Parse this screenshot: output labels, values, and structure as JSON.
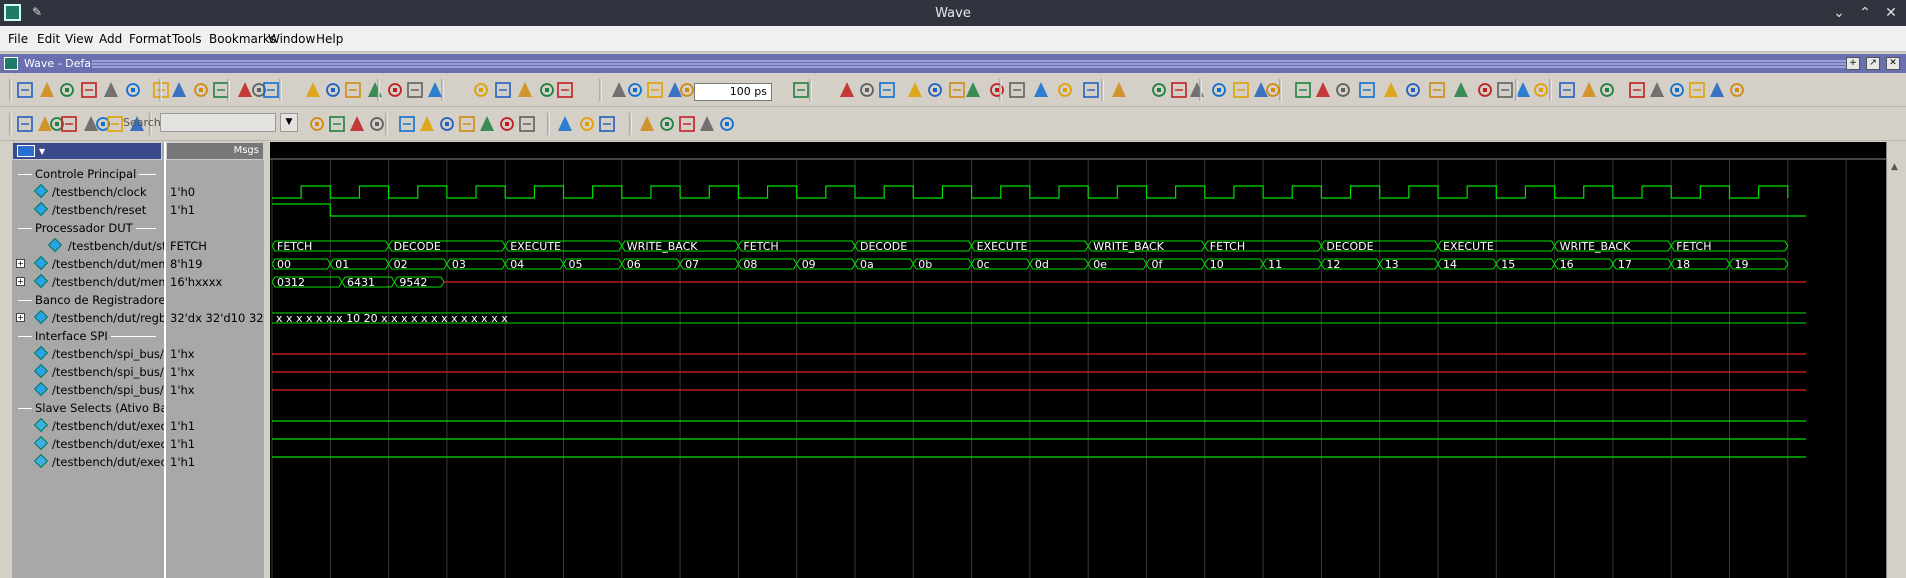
{
  "window": {
    "title": "Wave"
  },
  "menu": [
    "File",
    "Edit",
    "View",
    "Add",
    "Format",
    "Tools",
    "Bookmarks",
    "Window",
    "Help"
  ],
  "subwindow": {
    "title": "Wave - Default"
  },
  "toolbar": {
    "time_value": "100",
    "time_unit": "ps",
    "search_label": "Search:"
  },
  "columns": {
    "msgs": "Msgs"
  },
  "signals": [
    {
      "type": "group",
      "name": "Controle Principal"
    },
    {
      "type": "signal",
      "name": "/testbench/clock",
      "value": "1'h0",
      "icon": "wire-signal-icon"
    },
    {
      "type": "signal",
      "name": "/testbench/reset",
      "value": "1'h1",
      "icon": "wire-signal-icon"
    },
    {
      "type": "group",
      "name": "Processador DUT"
    },
    {
      "type": "signal",
      "name": "/testbench/dut/st...",
      "value": "FETCH",
      "icon": "state-machine-icon"
    },
    {
      "type": "signal",
      "name": "/testbench/dut/mem...",
      "value": "8'h19",
      "icon": "bus-signal-icon",
      "expandable": true
    },
    {
      "type": "signal",
      "name": "/testbench/dut/mem...",
      "value": "16'hxxxx",
      "icon": "bus-signal-icon",
      "expandable": true
    },
    {
      "type": "group",
      "name": "Banco de Registradores"
    },
    {
      "type": "signal",
      "name": "/testbench/dut/regb...",
      "value": "32'dx 32'd10 32'd...",
      "icon": "bus-signal-icon",
      "expandable": true
    },
    {
      "type": "group",
      "name": "Interface SPI"
    },
    {
      "type": "signal",
      "name": "/testbench/spi_bus/...",
      "value": "1'hx",
      "icon": "wire-signal-icon"
    },
    {
      "type": "signal",
      "name": "/testbench/spi_bus/...",
      "value": "1'hx",
      "icon": "wire-signal-icon"
    },
    {
      "type": "signal",
      "name": "/testbench/spi_bus/...",
      "value": "1'hx",
      "icon": "wire-signal-icon"
    },
    {
      "type": "group",
      "name": "Slave Selects (Ativo Bai"
    },
    {
      "type": "signal",
      "name": "/testbench/dut/exec...",
      "value": "1'h1",
      "icon": "output-signal-icon"
    },
    {
      "type": "signal",
      "name": "/testbench/dut/exec...",
      "value": "1'h1",
      "icon": "output-signal-icon"
    },
    {
      "type": "signal",
      "name": "/testbench/dut/exec...",
      "value": "1'h1",
      "icon": "output-signal-icon"
    }
  ],
  "waves": {
    "clock_cycles": 26,
    "state_segments": [
      "FETCH",
      "DECODE",
      "EXECUTE",
      "WRITE_BACK",
      "FETCH",
      "DECODE",
      "EXECUTE",
      "WRITE_BACK",
      "FETCH",
      "DECODE",
      "EXECUTE",
      "WRITE_BACK",
      "FETCH"
    ],
    "addr_values": [
      "00",
      "01",
      "02",
      "03",
      "04",
      "05",
      "06",
      "07",
      "08",
      "09",
      "0a",
      "0b",
      "0c",
      "0d",
      "0e",
      "0f",
      "10",
      "11",
      "12",
      "13",
      "14",
      "15",
      "16",
      "17",
      "18",
      "19"
    ],
    "data_values": [
      "0312",
      "6431",
      "9542"
    ],
    "regbank_values": [
      "x x x x x x...",
      "x 10 20 x x x x x x x x x x x x x"
    ],
    "colors": {
      "wire": "#00e000",
      "unknown": "#e02020",
      "grid": "#3a3a3a",
      "background": "#000000"
    }
  }
}
